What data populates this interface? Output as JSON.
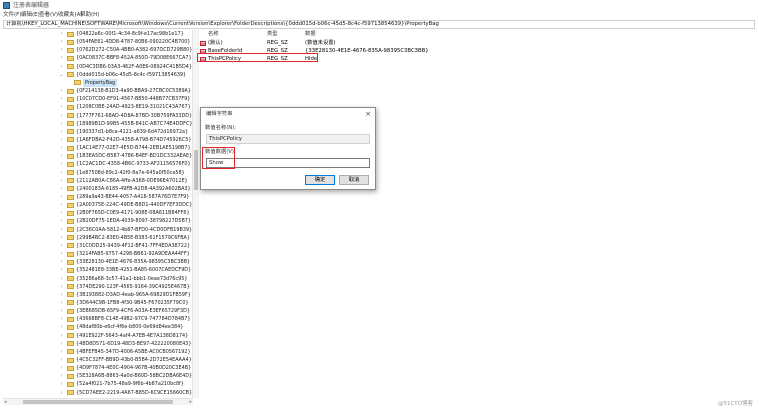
{
  "window": {
    "title": "注册表编辑器"
  },
  "menu": [
    "文件(F)",
    "编辑(E)",
    "查看(V)",
    "收藏夹(A)",
    "帮助(H)"
  ],
  "address": "计算机\\HKEY_LOCAL_MACHINE\\SOFTWARE\\Microsoft\\Windows\\CurrentVersion\\Explorer\\FolderDescriptions\\{0ddd015d-b06c-45d5-8c4c-f59713854639}\\PropertyBag",
  "tree": {
    "items": [
      "{04822e6c-00f1-4c34-8c9f-e17ac98b1e17}",
      "{054FAE61-4DD8-4787-80B6-090220C4B700}",
      "{0762D272-C50A-4BB0-A382-697DCD729B80}",
      "{0AC0837C-BBF8-452A-850D-79D08E667CA7}",
      "{0D4C3DB6-03A3-462F-A0E6-08924C41B5D4}",
      "{0ddd015d-b06c-45d5-8c4c-f59713854639}",
      "PropertyBag",
      "{0F214138-B1D3-4a90-BBA9-27CBC0C5389A}",
      "{10C07CD0-EF91-4567-B850-448B77CB37F9}",
      "{1208C0BE-24AD-4923-8E19-31021C43A767}",
      "{1777F761-68AD-4D8A-87BD-30B759FA33DD}",
      "{18989B1D-99B5-455B-841C-AB7C74E4DDFC}",
      "{190337d1-b8ca-4121-a639-6d472d16972a}",
      "{1A6FDBA2-F42D-4358-A798-B74D745926C5}",
      "{1AC14E77-02E7-4E5D-B744-2EB1AE5198B7}",
      "{1B3EA5DC-B587-4786-B4EF-BD1DC332AEAE}",
      "{1C2AC1DC-4358-4B6C-9733-AF21156576F0}",
      "{1e87508d-89c2-42f0-8a7e-645a0f50ca58}",
      "{2112AB0A-C86A-4ffe-A368-0DE96E47012E}",
      "{2400183A-6185-49FB-A2D8-4A392A602BA3}",
      "{289a9a43-BE44-4057-A418-587A76D7E7F9}",
      "{2A00375E-224C-49DE-B8D1-440DF7EF3DDC}",
      "{2B0F765D-C0E9-4171-908E-08A611B84FF6}",
      "{2B20DF75-1EDA-4039-8097-38798227D5B7}",
      "{2C36C0AA-5812-4b87-BFD0-4CD0DFB19B39}",
      "{299B4BC2-83E0-4B5E-B383-61F1579C6FBA}",
      "{31C0DD25-9439-4F12-BF41-7FF4EDA38722}",
      "{3214FAB5-9757-4298-BB61-92A9DEAA44FF}",
      "{33E28130-4E1E-4676-835A-98395C3BC3BB}",
      "{352481E8-33BE-4251-BA85-6007CAEDCF9D}",
      "{35286a68-3c57-41a1-bbb1-0eae73d76c95}",
      "{374DE290-123F-4565-9164-39C4925E467B}",
      "{3B193882-D3AD-4eab-965A-69829D1FB59F}",
      "{3D644C9B-1FB8-4f30-9B45-F670235F79C0}",
      "{3EB685DB-65F9-4CF6-A03A-E3EF65729F3D}",
      "{43668BF8-C14E-49B2-97C9-747784D784B7}",
      "{48daf80b-e6cf-4f6e-b800-0e69d84ee384}",
      "{491E922F-5643-4af4-A7EB-4E7A138D8174}",
      "{48D8D571-6D19-48D3-BE97-422220080E43}",
      "{4BFEFB45-347D-4006-A5BE-AC0CB0567192}",
      "{4C5C32FF-BB9D-43b0-B5B4-2D72E54EAAA4}",
      "{4D9F7874-4E0C-4904-967B-40B0D20C3E4B}",
      "{5E328A6B-8863-4a0d-B60D-58BC2DBA6E4D}",
      "{52a4f021-7b75-48a9-9f6b-4b87a210bc8f}",
      "{5CD7AEE2-2219-4A67-B85D-6C9CE15660CB}"
    ]
  },
  "values": {
    "headers": {
      "name": "名称",
      "type": "类型",
      "data": "数据"
    },
    "rows": [
      {
        "name": "(默认)",
        "type": "REG_SZ",
        "data": "(数值未设置)",
        "icon": "ab"
      },
      {
        "name": "BaseFolderId",
        "type": "REG_SZ",
        "data": "{33E28130-4E1E-4676-835A-98395C3BC3BB}",
        "icon": "ab"
      },
      {
        "name": "ThisPCPolicy",
        "type": "REG_SZ",
        "data": "Hide",
        "icon": "ab"
      }
    ]
  },
  "dialog": {
    "title": "编辑字符串",
    "name_label": "数值名称(N):",
    "name_value": "ThisPCPolicy",
    "data_label": "数值数据(V):",
    "data_value": "Show",
    "ok": "确定",
    "cancel": "取消"
  },
  "watermark": "@51CTO博客",
  "colors": {
    "highlight": "#e0252b",
    "selection": "#cce4f7",
    "accent": "#0078d7"
  }
}
